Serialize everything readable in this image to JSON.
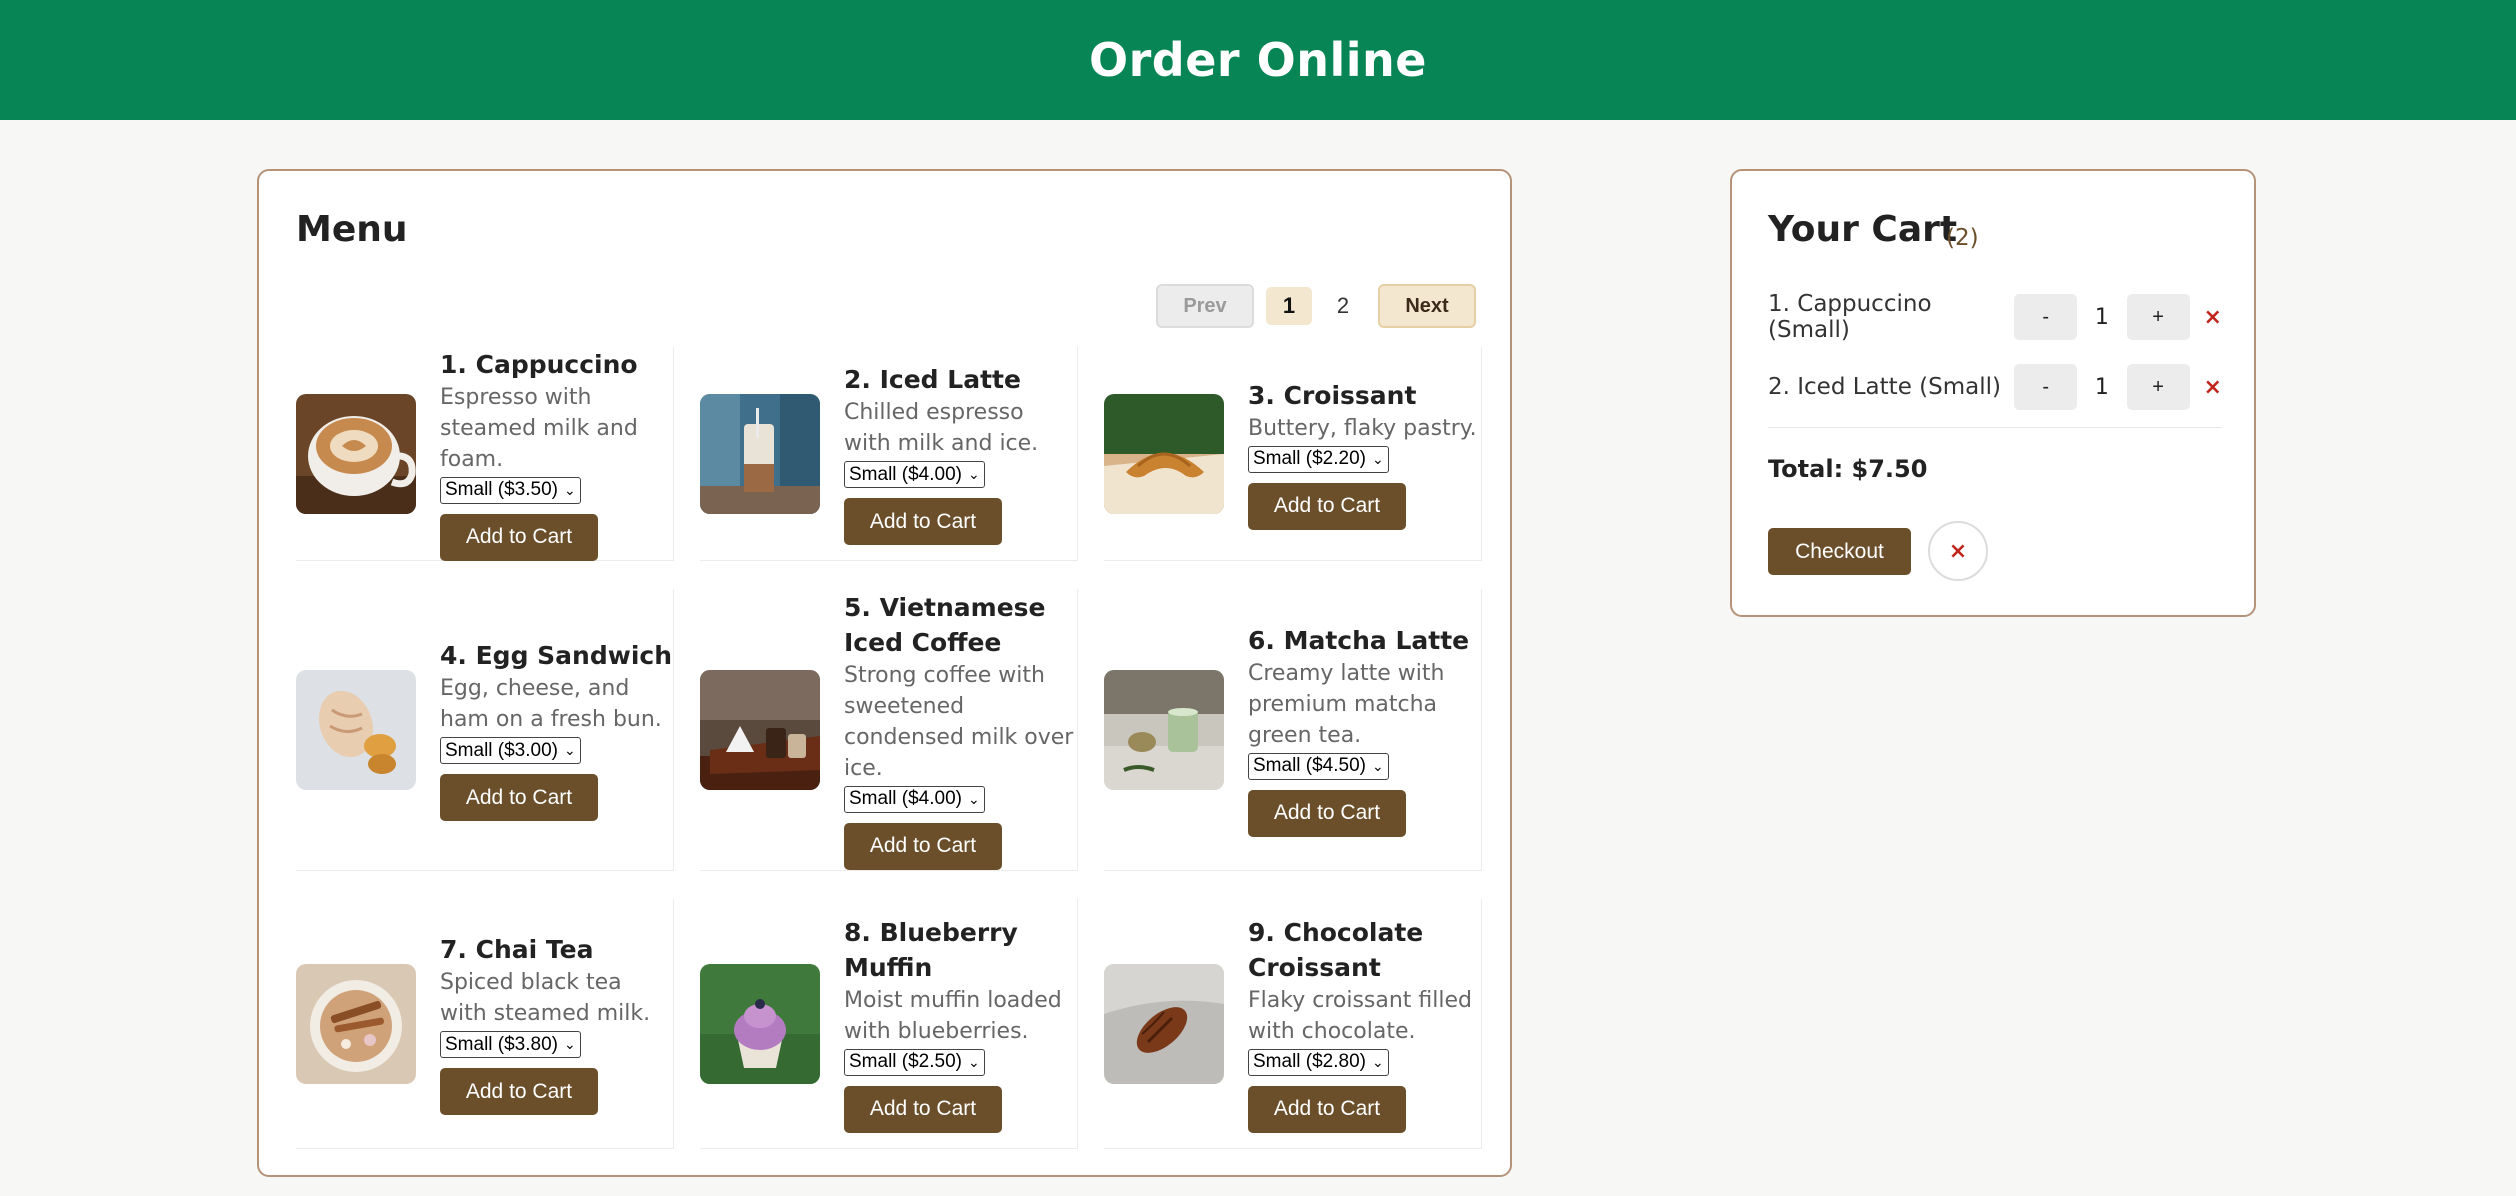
{
  "header": {
    "title": "Order Online"
  },
  "menu": {
    "title": "Menu",
    "pagination": {
      "prev_label": "Prev",
      "pages": [
        "1",
        "2"
      ],
      "current_page": "1",
      "next_label": "Next"
    },
    "items": [
      {
        "name": "1. Cappuccino",
        "description": "Espresso with steamed milk and foam.",
        "size_option": "Small ($3.50)",
        "button_label": "Add to Cart",
        "image": "cappuccino-photo"
      },
      {
        "name": "2. Iced Latte",
        "description": "Chilled espresso with milk and ice.",
        "size_option": "Small ($4.00)",
        "button_label": "Add to Cart",
        "image": "iced-latte-photo"
      },
      {
        "name": "3. Croissant",
        "description": "Buttery, flaky pastry.",
        "size_option": "Small ($2.20)",
        "button_label": "Add to Cart",
        "image": "croissant-photo"
      },
      {
        "name": "4. Egg Sandwich",
        "description": "Egg, cheese, and ham on a fresh bun.",
        "size_option": "Small ($3.00)",
        "button_label": "Add to Cart",
        "image": "egg-sandwich-photo"
      },
      {
        "name": "5. Vietnamese Iced Coffee",
        "description": "Strong coffee with sweetened condensed milk over ice.",
        "size_option": "Small ($4.00)",
        "button_label": "Add to Cart",
        "image": "vietnamese-iced-coffee-photo"
      },
      {
        "name": "6. Matcha Latte",
        "description": "Creamy latte with premium matcha green tea.",
        "size_option": "Small ($4.50)",
        "button_label": "Add to Cart",
        "image": "matcha-latte-photo"
      },
      {
        "name": "7. Chai Tea",
        "description": "Spiced black tea with steamed milk.",
        "size_option": "Small ($3.80)",
        "button_label": "Add to Cart",
        "image": "chai-tea-photo"
      },
      {
        "name": "8. Blueberry Muffin",
        "description": "Moist muffin loaded with blueberries.",
        "size_option": "Small ($2.50)",
        "button_label": "Add to Cart",
        "image": "blueberry-muffin-photo"
      },
      {
        "name": "9. Chocolate Croissant",
        "description": "Flaky croissant filled with chocolate.",
        "size_option": "Small ($2.80)",
        "button_label": "Add to Cart",
        "image": "chocolate-croissant-photo"
      }
    ]
  },
  "cart": {
    "title": "Your Cart",
    "count": "(2)",
    "items": [
      {
        "name": "1. Cappuccino (Small)",
        "minus": "-",
        "qty": "1",
        "plus": "+",
        "remove": "×"
      },
      {
        "name": "2. Iced Latte (Small)",
        "minus": "-",
        "qty": "1",
        "plus": "+",
        "remove": "×"
      }
    ],
    "total": "Total: $7.50",
    "checkout_label": "Checkout",
    "clear_label": "×"
  },
  "colors": {
    "header_bg": "#078554",
    "accent_brown": "#6b4f2a",
    "panel_border": "#b59278",
    "remove_red": "#c0261d"
  }
}
